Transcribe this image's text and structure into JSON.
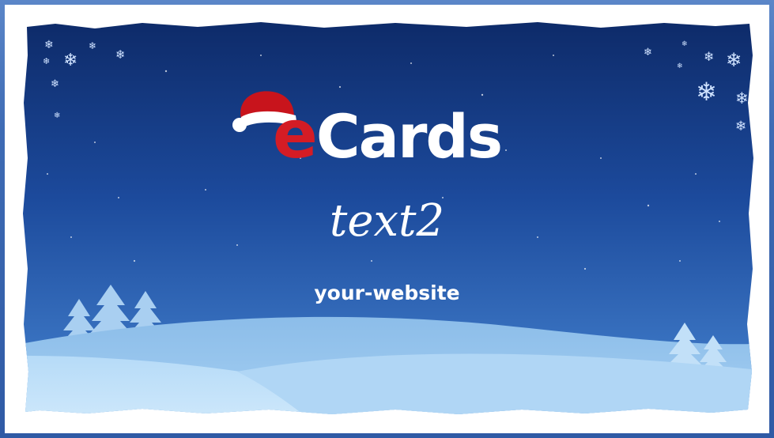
{
  "card": {
    "logo_e": "e",
    "logo_rest": "Cards",
    "subtitle": "text2",
    "website": "your-website"
  },
  "icons": {
    "hat": "santa-hat-icon",
    "snowflake": "snowflake-icon",
    "tree": "pine-tree-icon"
  },
  "colors": {
    "sky_top": "#0d2a66",
    "sky_bottom": "#3f7fd0",
    "snow_light": "#bcdcf7",
    "snow_mid": "#8fc0ea",
    "logo_red": "#d41c25",
    "white": "#ffffff"
  }
}
